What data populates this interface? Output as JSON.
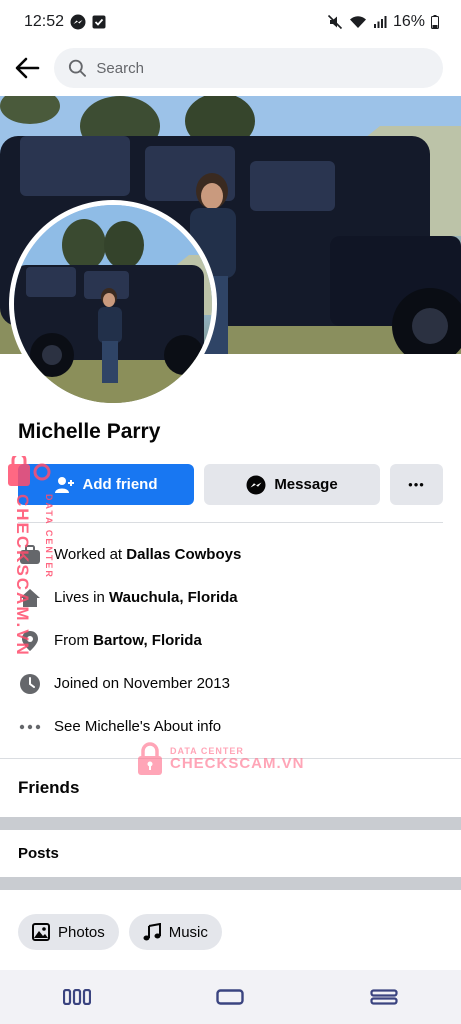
{
  "status_bar": {
    "time": "12:52",
    "battery": "16%"
  },
  "search": {
    "placeholder": "Search"
  },
  "profile": {
    "name": "Michelle Parry"
  },
  "actions": {
    "add_friend": "Add friend",
    "message": "Message",
    "more": "•••"
  },
  "about": [
    {
      "icon": "briefcase-icon",
      "prefix": "Worked at ",
      "value": "Dallas Cowboys"
    },
    {
      "icon": "home-icon",
      "prefix": "Lives in ",
      "value": "Wauchula, Florida"
    },
    {
      "icon": "location-pin-icon",
      "prefix": "From ",
      "value": "Bartow, Florida"
    },
    {
      "icon": "clock-icon",
      "prefix": "Joined on November 2013",
      "value": ""
    },
    {
      "icon": "more-dots-icon",
      "prefix": "See Michelle's About info",
      "value": ""
    }
  ],
  "sections": {
    "friends": "Friends",
    "posts": "Posts"
  },
  "chips": [
    {
      "icon": "photos-icon",
      "label": "Photos"
    },
    {
      "icon": "music-icon",
      "label": "Music"
    }
  ],
  "watermark": {
    "top": "DATA CENTER",
    "brand": "CHECKSCAM.VN"
  },
  "colors": {
    "primary": "#1877f2",
    "secondary_button": "#e4e6eb",
    "watermark": "#ff4d6d"
  }
}
